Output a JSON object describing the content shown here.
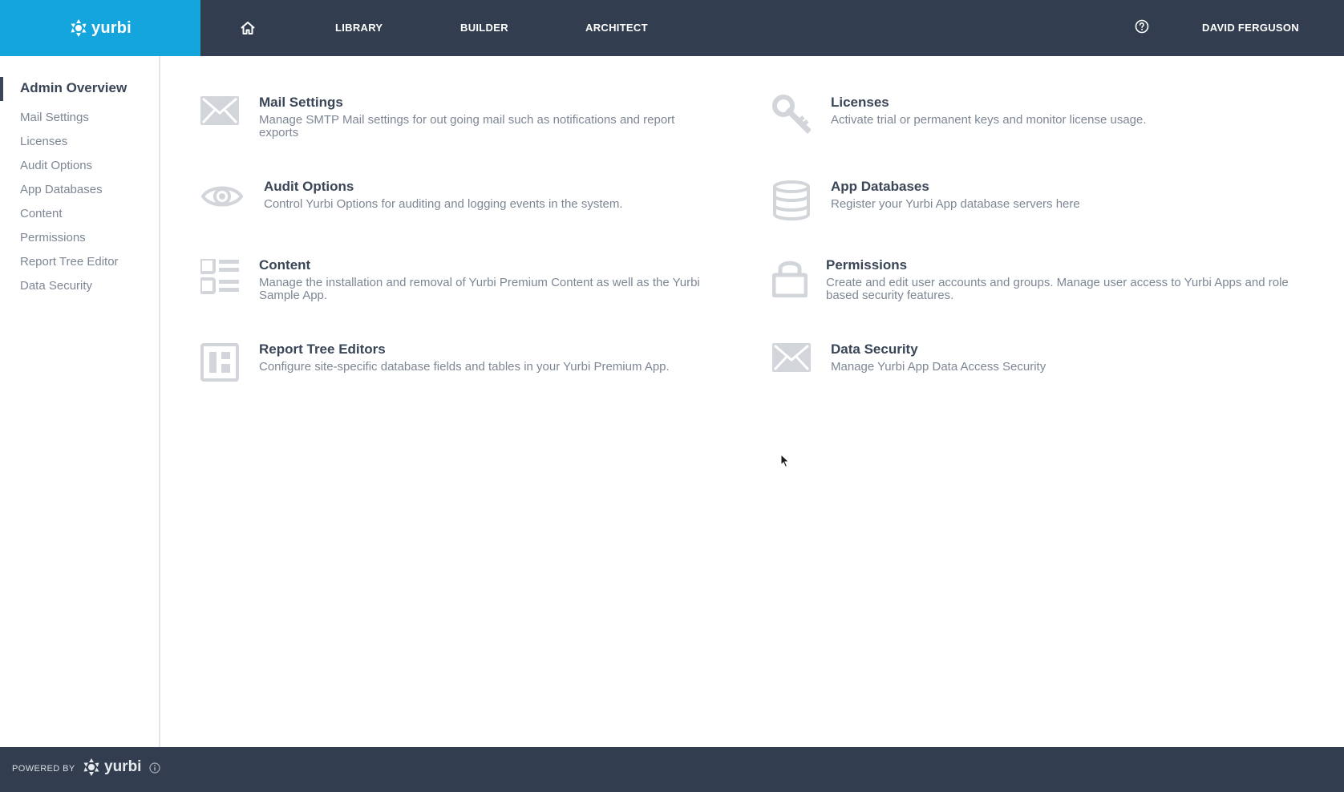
{
  "brand": {
    "name": "yurbi",
    "color": "#13a5dc"
  },
  "nav": {
    "home_icon": "home-icon",
    "links": [
      "LIBRARY",
      "BUILDER",
      "ARCHITECT"
    ],
    "help_icon": "help-icon",
    "user": "DAVID FERGUSON"
  },
  "sidebar": {
    "active": "Admin Overview",
    "items": [
      "Mail Settings",
      "Licenses",
      "Audit Options",
      "App Databases",
      "Content",
      "Permissions",
      "Report Tree Editor",
      "Data Security"
    ]
  },
  "cards": [
    {
      "title": "Mail Settings",
      "desc": "Manage SMTP Mail settings for out going mail such as notifications and report exports",
      "icon": "mail-icon"
    },
    {
      "title": "Licenses",
      "desc": "Activate trial or permanent keys and monitor license usage.",
      "icon": "key-icon"
    },
    {
      "title": "Audit Options",
      "desc": "Control Yurbi Options for auditing and logging events in the system.",
      "icon": "eye-icon"
    },
    {
      "title": "App Databases",
      "desc": "Register your Yurbi App database servers here",
      "icon": "database-icon"
    },
    {
      "title": "Content",
      "desc": "Manage the installation and removal of Yurbi Premium Content as well as the Yurbi Sample App.",
      "icon": "list-icon"
    },
    {
      "title": "Permissions",
      "desc": "Create and edit user accounts and groups. Manage user access to Yurbi Apps and role based security features.",
      "icon": "lock-icon"
    },
    {
      "title": "Report Tree Editors",
      "desc": "Configure site-specific database fields and tables in your Yurbi Premium App.",
      "icon": "layout-icon"
    },
    {
      "title": "Data Security",
      "desc": "Manage Yurbi App Data Access Security",
      "icon": "mail-icon"
    }
  ],
  "footer": {
    "powered_by": "POWERED BY",
    "brand": "yurbi"
  },
  "colors": {
    "topbar": "#323e4f",
    "accent": "#13a5dc",
    "icon": "#d2d6da"
  }
}
